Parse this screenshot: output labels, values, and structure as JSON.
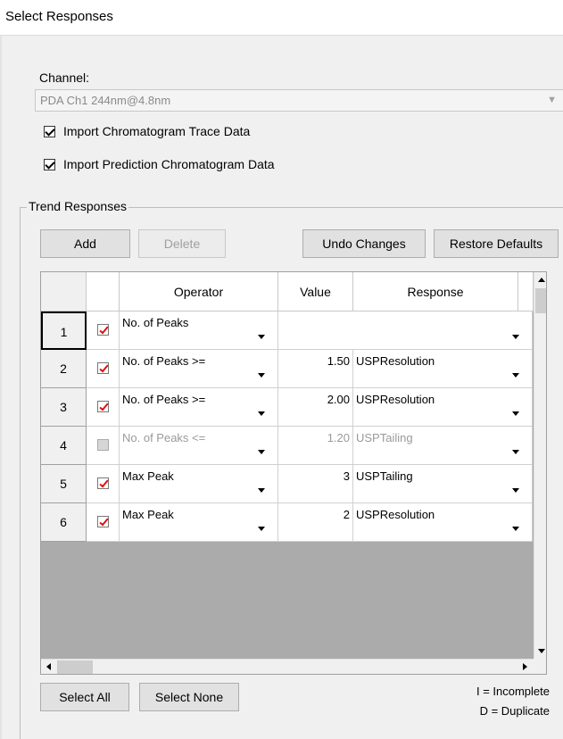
{
  "window": {
    "title": "Select Responses"
  },
  "channel": {
    "label": "Channel:",
    "value": "PDA Ch1 244nm@4.8nm"
  },
  "options": [
    {
      "label": "Import Chromatogram Trace Data",
      "checked": true
    },
    {
      "label": "Import Prediction Chromatogram Data",
      "checked": true
    }
  ],
  "trend": {
    "title": "Trend Responses",
    "buttons": {
      "add": "Add",
      "delete": "Delete",
      "undo": "Undo Changes",
      "restore": "Restore Defaults"
    }
  },
  "grid": {
    "columns": {
      "operator": "Operator",
      "value": "Value",
      "response": "Response"
    },
    "rows": [
      {
        "num": "1",
        "checked": true,
        "operator": "No. of Peaks",
        "value": "",
        "response": ""
      },
      {
        "num": "2",
        "checked": true,
        "operator": "No. of Peaks >=",
        "value": "1.50",
        "response": "USPResolution"
      },
      {
        "num": "3",
        "checked": true,
        "operator": "No. of Peaks >=",
        "value": "2.00",
        "response": "USPResolution"
      },
      {
        "num": "4",
        "checked": false,
        "operator": "No. of Peaks <=",
        "value": "1.20",
        "response": "USPTailing"
      },
      {
        "num": "5",
        "checked": true,
        "operator": "Max Peak",
        "value": "3",
        "response": "USPTailing"
      },
      {
        "num": "6",
        "checked": true,
        "operator": "Max Peak",
        "value": "2",
        "response": "USPResolution"
      }
    ]
  },
  "footer": {
    "select_all": "Select All",
    "select_none": "Select None",
    "legend_incomplete": "I = Incomplete",
    "legend_duplicate": "D = Duplicate"
  }
}
